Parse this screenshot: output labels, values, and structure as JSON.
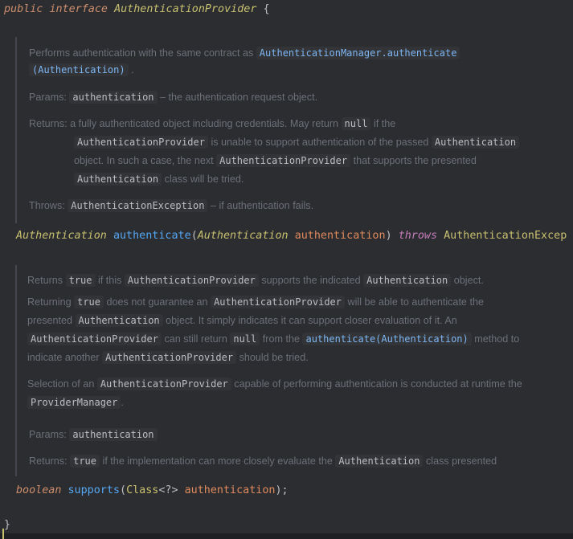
{
  "header": {
    "kw_public": "public",
    "kw_interface": "interface",
    "name": "AuthenticationProvider",
    "brace": "{"
  },
  "doc1": {
    "line1_pre": "Performs authentication with the same contract as",
    "line1_tag": "AuthenticationManager.authenticate",
    "line2_tag": "(Authentication)",
    "line2_post": ".",
    "params_label": "Params:",
    "params_tag": "authentication",
    "params_text": "– the authentication request object.",
    "returns_label": "Returns:",
    "returns_a": "a fully authenticated object including credentials. May return",
    "returns_null": "null",
    "returns_b": "if the",
    "returns_tag2": "AuthenticationProvider",
    "returns_c": "is unable to support authentication of the passed",
    "returns_tag3": "Authentication",
    "returns_d": "object. In such a case, the next",
    "returns_tag4": "AuthenticationProvider",
    "returns_e": "that supports the presented",
    "returns_tag5": "Authentication",
    "returns_f": "class will be tried.",
    "throws_label": "Throws:",
    "throws_tag": "AuthenticationException",
    "throws_text": "– if authentication fails."
  },
  "method1": {
    "ret": "Authentication",
    "name": "authenticate",
    "open": "(",
    "ptype": "Authentication",
    "pname": "authentication",
    "close": ")",
    "throws": "throws",
    "ex": "AuthenticationExcep"
  },
  "doc2": {
    "r1_a": "Returns",
    "r1_true": "true",
    "r1_b": "if this",
    "r1_tag": "AuthenticationProvider",
    "r1_c": "supports the indicated",
    "r1_tag2": "Authentication",
    "r1_d": "object.",
    "p2_a": "Returning",
    "p2_true": "true",
    "p2_b": "does not guarantee an",
    "p2_tag": "AuthenticationProvider",
    "p2_c": "will be able to authenticate the",
    "p2_d": "presented",
    "p2_tag2": "Authentication",
    "p2_e": "object. It simply indicates it can support closer evaluation of it. An",
    "p2_tag3": "AuthenticationProvider",
    "p2_f": "can still return",
    "p2_null": "null",
    "p2_g": "from the",
    "p2_link": "authenticate(Authentication)",
    "p2_h": "method to",
    "p2_i": "indicate another",
    "p2_tag4": "AuthenticationProvider",
    "p2_j": "should be tried.",
    "p3_a": "Selection of an",
    "p3_tag": "AuthenticationProvider",
    "p3_b": "capable of performing authentication is conducted at runtime the",
    "p3_tag2": "ProviderManager",
    "p3_c": ".",
    "params_label": "Params:",
    "params_tag": "authentication",
    "returns_label": "Returns:",
    "returns_true": "true",
    "returns_a": "if the implementation can more closely evaluate the",
    "returns_tag": "Authentication",
    "returns_b": "class presented"
  },
  "method2": {
    "ret": "boolean",
    "name": "supports",
    "open": "(",
    "ptype": "Class",
    "generic": "<?>",
    "pname": "authentication",
    "close": ");"
  },
  "footer": {
    "brace": "}"
  }
}
